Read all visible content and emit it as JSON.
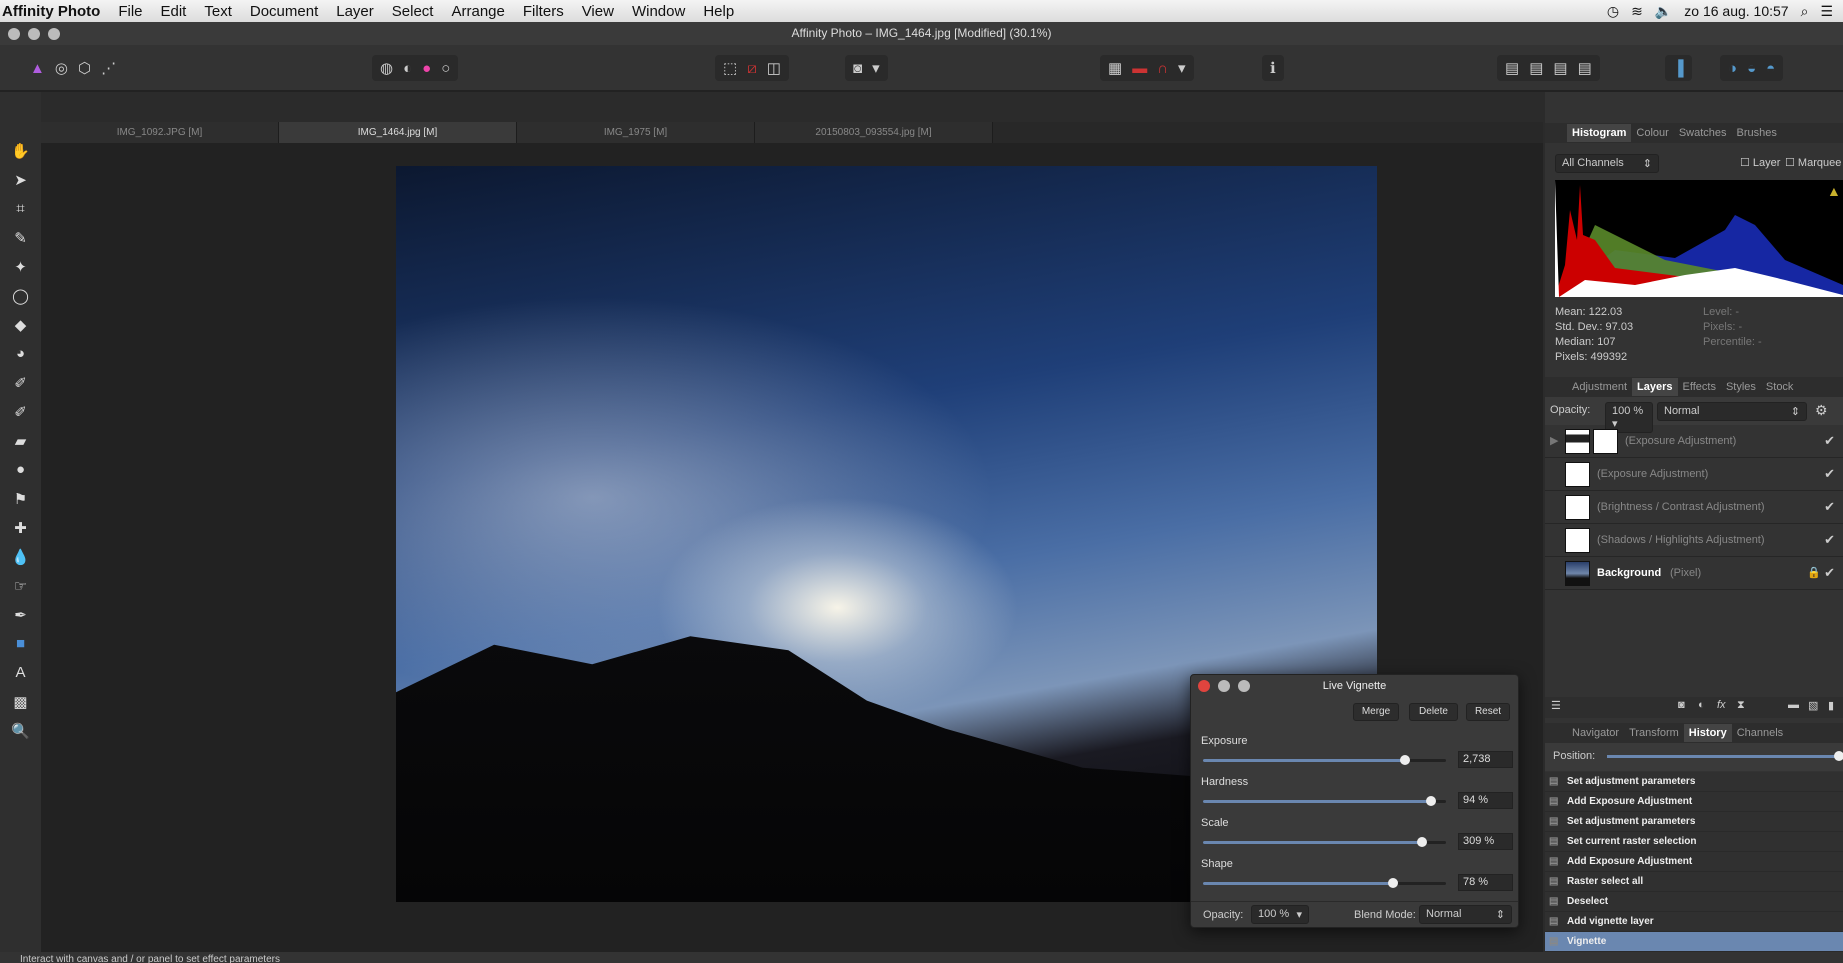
{
  "menubar": {
    "app": "Affinity Photo",
    "items": [
      "File",
      "Edit",
      "Text",
      "Document",
      "Layer",
      "Select",
      "Arrange",
      "Filters",
      "View",
      "Window",
      "Help"
    ],
    "clock": "zo 16 aug. 10:57"
  },
  "window": {
    "title": "Affinity Photo – IMG_1464.jpg [Modified] (30.1%)"
  },
  "doc_tabs": [
    "IMG_1092.JPG [M]",
    "IMG_1464.jpg [M]",
    "IMG_1975 [M]",
    "20150803_093554.jpg [M]"
  ],
  "histogram": {
    "tabs": [
      "Histogram",
      "Colour",
      "Swatches",
      "Brushes"
    ],
    "channel": "All Channels",
    "layer_label": "Layer",
    "marquee_label": "Marquee",
    "mean": "Mean: 122.03",
    "std": "Std. Dev.: 97.03",
    "median": "Median: 107",
    "pixels": "Pixels: 499392",
    "level": "Level: -",
    "pixels_r": "Pixels: -",
    "percentile": "Percentile: -"
  },
  "layers": {
    "tabs": [
      "Adjustment",
      "Layers",
      "Effects",
      "Styles",
      "Stock"
    ],
    "opacity_label": "Opacity:",
    "opacity": "100 %",
    "blend": "Normal",
    "items": [
      {
        "name": "(Exposure Adjustment)"
      },
      {
        "name": "(Exposure Adjustment)"
      },
      {
        "name": "(Brightness / Contrast Adjustment)"
      },
      {
        "name": "(Shadows / Highlights Adjustment)"
      },
      {
        "name": "Background",
        "type": "(Pixel)"
      }
    ]
  },
  "history": {
    "tabs": [
      "Navigator",
      "Transform",
      "History",
      "Channels"
    ],
    "position_label": "Position:",
    "items": [
      "Set adjustment parameters",
      "Add Exposure Adjustment",
      "Set adjustment parameters",
      "Set current raster selection",
      "Add Exposure Adjustment",
      "Raster select all",
      "Deselect",
      "Add vignette layer",
      "Vignette"
    ]
  },
  "vignette": {
    "title": "Live Vignette",
    "merge": "Merge",
    "delete": "Delete",
    "reset": "Reset",
    "sliders": [
      {
        "label": "Exposure",
        "value": "2,738",
        "fraction": 0.83
      },
      {
        "label": "Hardness",
        "value": "94 %",
        "fraction": 0.94
      },
      {
        "label": "Scale",
        "value": "309 %",
        "fraction": 0.9
      },
      {
        "label": "Shape",
        "value": "78 %",
        "fraction": 0.78
      }
    ],
    "opacity_label": "Opacity:",
    "opacity": "100 %",
    "blend_label": "Blend Mode:",
    "blend": "Normal"
  },
  "status": "Interact with canvas and / or panel to set effect parameters",
  "colors": {
    "accent": "#6a87b0",
    "close": "#e0443e"
  }
}
